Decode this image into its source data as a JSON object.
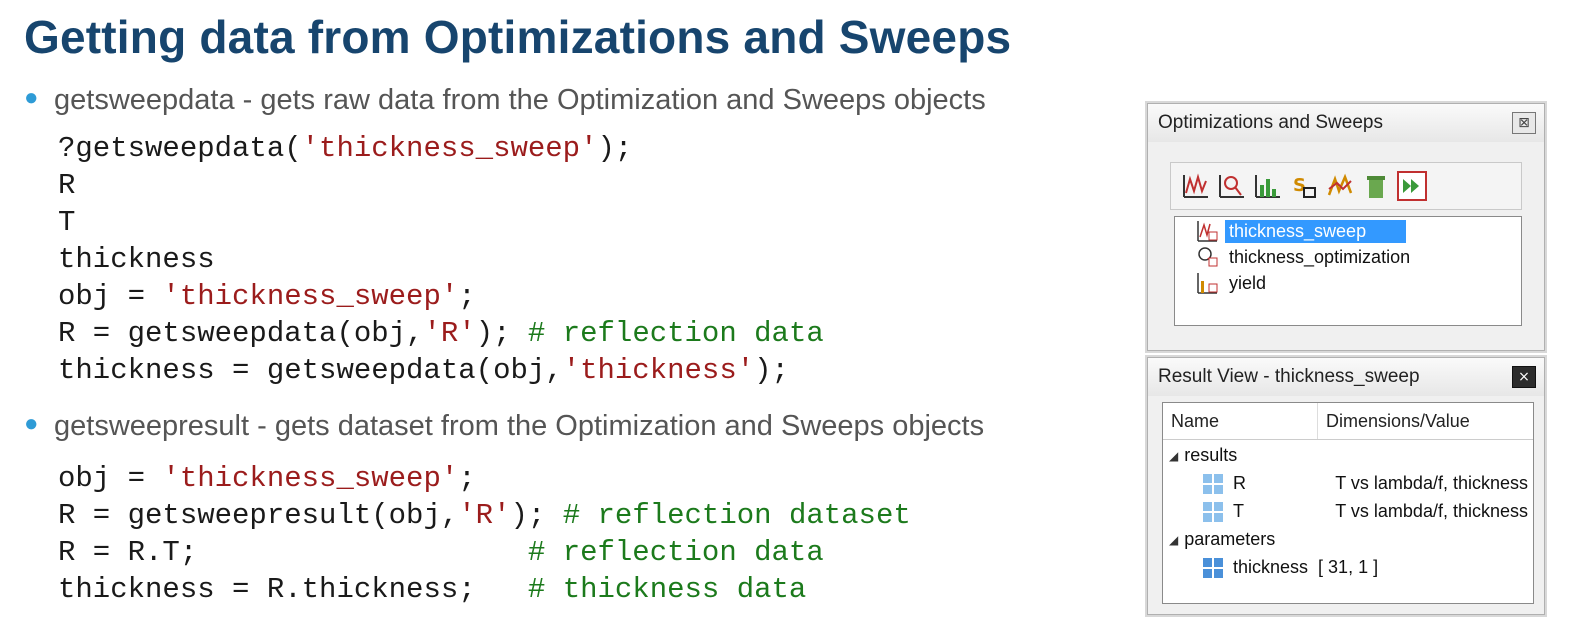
{
  "title": "Getting data from Optimizations and Sweeps",
  "bullets": [
    "getsweepdata - gets raw data from the Optimization and Sweeps objects",
    "getsweepresult - gets dataset from the Optimization and Sweeps objects"
  ],
  "code1": {
    "l1_a": "?getsweepdata(",
    "l1_s": "'thickness_sweep'",
    "l1_b": ");",
    "l2": "R",
    "l3": "T",
    "l4": "thickness",
    "l5_a": "obj = ",
    "l5_s": "'thickness_sweep'",
    "l5_b": ";",
    "l6_a": "R = getsweepdata(obj,",
    "l6_s": "'R'",
    "l6_b": "); ",
    "l6_c": "# reflection data",
    "l7_a": "thickness = getsweepdata(obj,",
    "l7_s": "'thickness'",
    "l7_b": ");"
  },
  "code2": {
    "l1_a": "obj = ",
    "l1_s": "'thickness_sweep'",
    "l1_b": ";",
    "l2_a": "R = getsweepresult(obj,",
    "l2_s": "'R'",
    "l2_b": "); ",
    "l2_c": "# reflection dataset",
    "l3_a": "R = R.T;                   ",
    "l3_c": "# reflection data",
    "l4_a": "thickness = R.thickness;   ",
    "l4_c": "# thickness data"
  },
  "opt_window": {
    "title": "Optimizations and Sweeps",
    "close": "⊠",
    "toolbar_icons": [
      "sweep-icon",
      "optimization-icon",
      "yield-icon",
      "s-parameter-icon",
      "nested-sweep-icon",
      "delete-icon",
      "run-icon"
    ],
    "items": [
      "thickness_sweep",
      "thickness_optimization",
      "yield"
    ]
  },
  "result_window": {
    "title": "Result View - thickness_sweep",
    "close": "×",
    "col_name": "Name",
    "col_value": "Dimensions/Value",
    "group_results": "results",
    "group_parameters": "parameters",
    "rows": [
      {
        "name": "R",
        "value": "T vs lambda/f, thickness"
      },
      {
        "name": "T",
        "value": "T vs lambda/f, thickness"
      },
      {
        "name": "thickness",
        "value": "[ 31, 1 ]"
      }
    ]
  },
  "colors": {
    "title": "#17456e",
    "bullet": "#2e9bd6",
    "string": "#9b1c1c",
    "comment": "#1c7a1c",
    "selection": "#3399ff"
  }
}
